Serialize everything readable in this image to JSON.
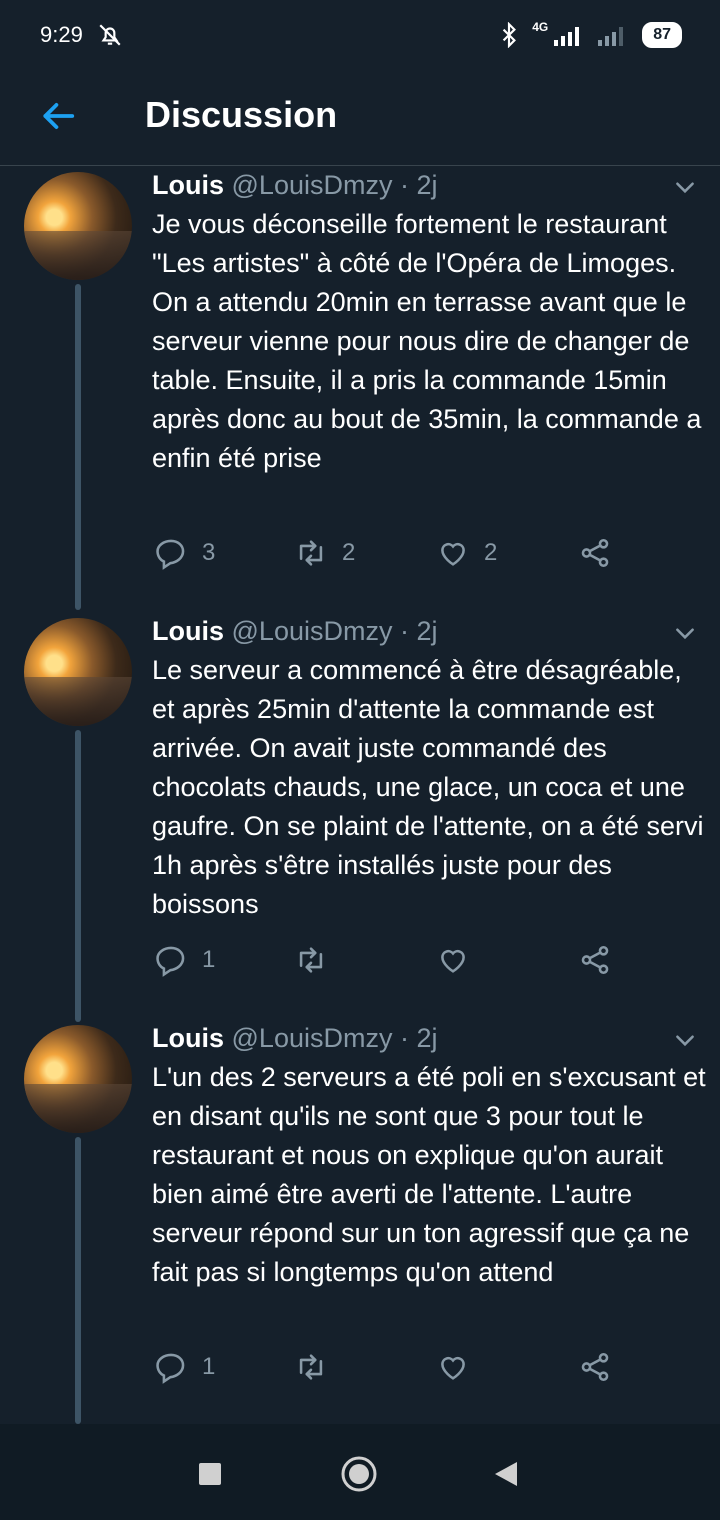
{
  "status_bar": {
    "time": "9:29",
    "network": "4G",
    "battery": "87"
  },
  "app_bar": {
    "title": "Discussion"
  },
  "tweets": [
    {
      "name": "Louis",
      "handle": "@LouisDmzy",
      "separator": "·",
      "time": "2j",
      "text": "Je vous déconseille fortement le restaurant \"Les artistes\" à côté de l'Opéra de Limoges. On a attendu 20min en terrasse avant que le serveur vienne pour nous dire de changer de table. Ensuite, il a pris la commande 15min après donc au bout de 35min, la commande a enfin été prise",
      "replies": "3",
      "retweets": "2",
      "likes": "2"
    },
    {
      "name": "Louis",
      "handle": "@LouisDmzy",
      "separator": "·",
      "time": "2j",
      "text": "Le serveur a commencé à être désagréable, et après 25min d'attente la commande est arrivée. On avait juste commandé des chocolats chauds, une glace, un coca et une gaufre. On se plaint de l'attente, on a été servi 1h après s'être installés juste pour des boissons",
      "replies": "1",
      "retweets": "",
      "likes": ""
    },
    {
      "name": "Louis",
      "handle": "@LouisDmzy",
      "separator": "·",
      "time": "2j",
      "text": "L'un des 2 serveurs a été poli en s'excusant et en disant qu'ils ne sont que 3 pour tout le restaurant et nous on explique qu'on aurait bien aimé être averti de l'attente. L'autre serveur répond sur un ton agressif que ça ne fait pas si longtemps qu'on attend",
      "replies": "1",
      "retweets": "",
      "likes": ""
    }
  ],
  "colors": {
    "background": "#15202b",
    "accent": "#1da1f2",
    "secondary_text": "#8899a6"
  }
}
